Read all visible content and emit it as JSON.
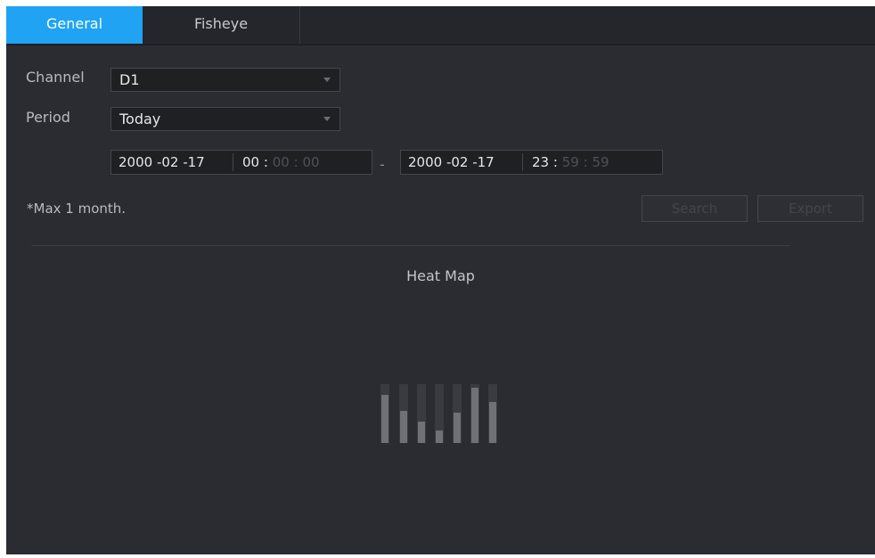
{
  "tabs": [
    {
      "label": "General",
      "active": true
    },
    {
      "label": "Fisheye",
      "active": false
    }
  ],
  "form": {
    "channel_label": "Channel",
    "channel_value": "D1",
    "period_label": "Period",
    "period_value": "Today",
    "start": {
      "date": "2000 -02 -17",
      "hh": "00",
      "mm": "00",
      "ss": "00"
    },
    "end": {
      "date": "2000 -02 -17",
      "hh": "23",
      "mm": "59",
      "ss": "59"
    },
    "range_separator": "-",
    "colon": ":",
    "note": "*Max 1 month."
  },
  "buttons": {
    "search": "Search",
    "export": "Export"
  },
  "main": {
    "title": "Heat Map"
  },
  "colors": {
    "accent": "#1fa3f2",
    "background": "#2b2c31"
  },
  "icons": {
    "empty_state": "bar-chart-placeholder-icon",
    "dropdown": "chevron-down-icon"
  }
}
